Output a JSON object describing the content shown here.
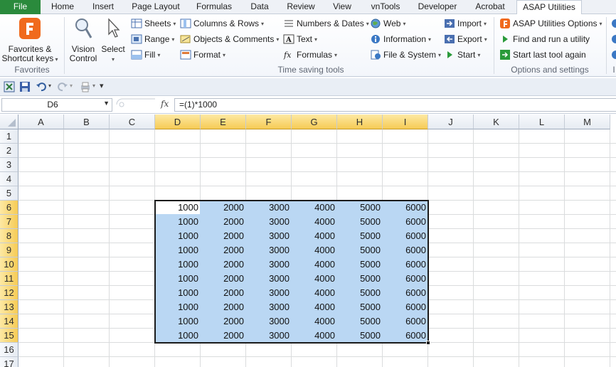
{
  "tabs": [
    {
      "label": "File",
      "kind": "file"
    },
    {
      "label": "Home"
    },
    {
      "label": "Insert"
    },
    {
      "label": "Page Layout"
    },
    {
      "label": "Formulas"
    },
    {
      "label": "Data"
    },
    {
      "label": "Review"
    },
    {
      "label": "View"
    },
    {
      "label": "vnTools"
    },
    {
      "label": "Developer"
    },
    {
      "label": "Acrobat"
    },
    {
      "label": "ASAP Utilities",
      "kind": "active"
    }
  ],
  "ribbon": {
    "favorites": {
      "line1": "Favorites &",
      "line2": "Shortcut keys",
      "group_label": "Favorites"
    },
    "vision_control": {
      "line1": "Vision",
      "line2": "Control"
    },
    "select": {
      "label": "Select"
    },
    "time_saving_tools": {
      "group_label": "Time saving tools",
      "items": [
        {
          "label": "Sheets",
          "icon": "sheets-icon"
        },
        {
          "label": "Range",
          "icon": "range-icon"
        },
        {
          "label": "Fill",
          "icon": "fill-icon"
        },
        {
          "label": "Columns & Rows",
          "icon": "columns-rows-icon"
        },
        {
          "label": "Objects & Comments",
          "icon": "objects-comments-icon"
        },
        {
          "label": "Format",
          "icon": "format-icon"
        },
        {
          "label": "Numbers & Dates",
          "icon": "numbers-dates-icon"
        },
        {
          "label": "Text",
          "icon": "text-icon"
        },
        {
          "label": "Formulas",
          "icon": "formulas-icon"
        },
        {
          "label": "Web",
          "icon": "web-icon"
        },
        {
          "label": "Information",
          "icon": "information-icon"
        },
        {
          "label": "File & System",
          "icon": "file-system-icon"
        },
        {
          "label": "Import",
          "icon": "import-icon"
        },
        {
          "label": "Export",
          "icon": "export-icon"
        },
        {
          "label": "Start",
          "icon": "start-icon"
        }
      ]
    },
    "options": {
      "group_label": "Options and settings",
      "items": [
        {
          "label": "ASAP Utilities Options",
          "icon": "asap-options-icon"
        },
        {
          "label": "Find and run a utility",
          "icon": "find-run-icon"
        },
        {
          "label": "Start last tool again",
          "icon": "start-last-icon"
        }
      ]
    },
    "overflow_label": "I"
  },
  "formula_bar": {
    "name_box": "D6",
    "fx_label": "fx",
    "formula": "=(1)*1000"
  },
  "sheet": {
    "columns": [
      "A",
      "B",
      "C",
      "D",
      "E",
      "F",
      "G",
      "H",
      "I",
      "J",
      "K",
      "L",
      "M"
    ],
    "rows": [
      "1",
      "2",
      "3",
      "4",
      "5",
      "6",
      "7",
      "8",
      "9",
      "10",
      "11",
      "12",
      "13",
      "14",
      "15",
      "16",
      "17"
    ],
    "selected_columns": [
      "D",
      "E",
      "F",
      "G",
      "H",
      "I"
    ],
    "selected_rows": [
      "6",
      "7",
      "8",
      "9",
      "10",
      "11",
      "12",
      "13",
      "14",
      "15"
    ],
    "active_cell": "D6",
    "data_rows": [
      [
        "1000",
        "2000",
        "3000",
        "4000",
        "5000",
        "6000"
      ],
      [
        "1000",
        "2000",
        "3000",
        "4000",
        "5000",
        "6000"
      ],
      [
        "1000",
        "2000",
        "3000",
        "4000",
        "5000",
        "6000"
      ],
      [
        "1000",
        "2000",
        "3000",
        "4000",
        "5000",
        "6000"
      ],
      [
        "1000",
        "2000",
        "3000",
        "4000",
        "5000",
        "6000"
      ],
      [
        "1000",
        "2000",
        "3000",
        "4000",
        "5000",
        "6000"
      ],
      [
        "1000",
        "2000",
        "3000",
        "4000",
        "5000",
        "6000"
      ],
      [
        "1000",
        "2000",
        "3000",
        "4000",
        "5000",
        "6000"
      ],
      [
        "1000",
        "2000",
        "3000",
        "4000",
        "5000",
        "6000"
      ],
      [
        "1000",
        "2000",
        "3000",
        "4000",
        "5000",
        "6000"
      ]
    ]
  },
  "colors": {
    "file_tab": "#2a8a3c",
    "selection_fill": "#bad7f3",
    "header_highlight": "#f6cb55"
  }
}
